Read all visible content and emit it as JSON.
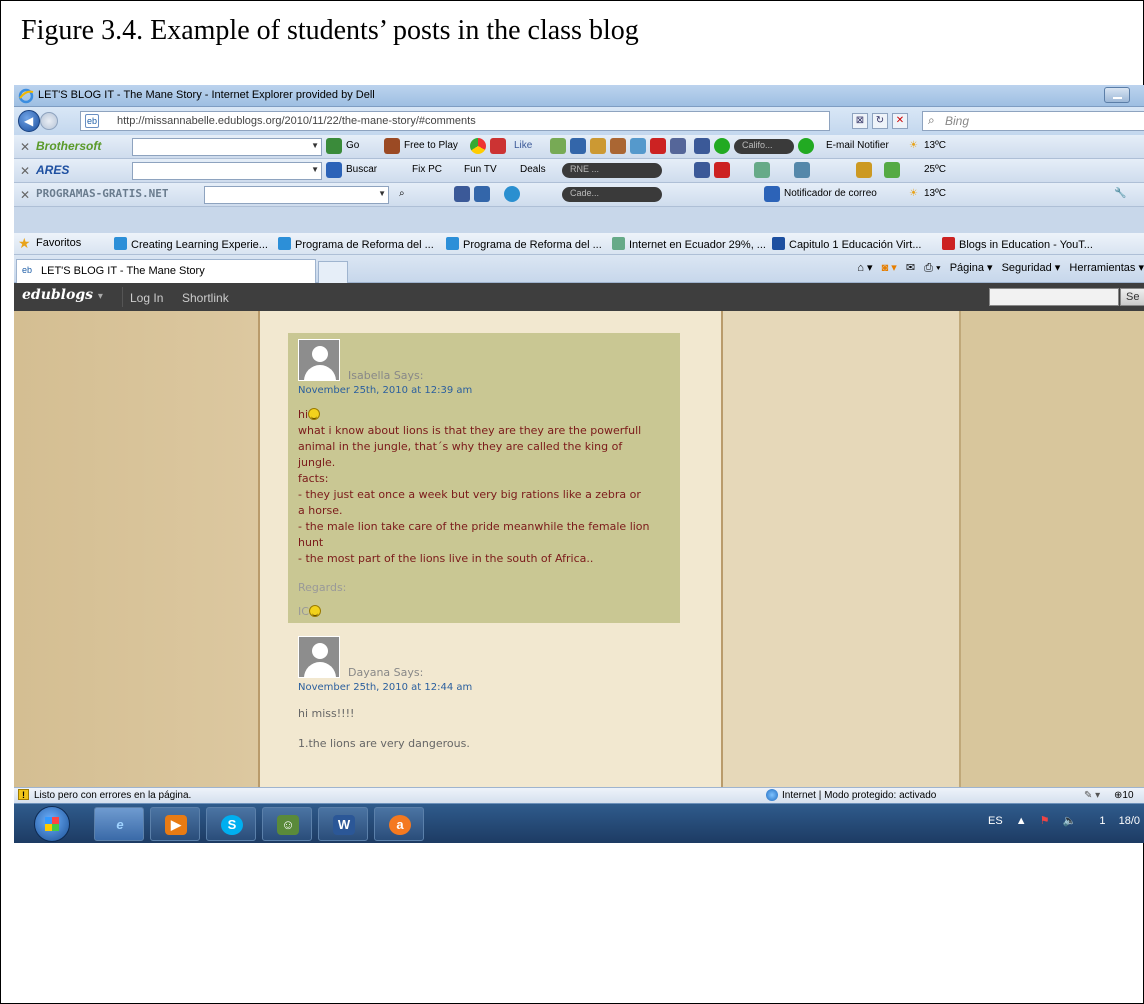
{
  "caption": "Figure 3.4. Example of students’ posts in the class blog",
  "browser": {
    "window_title": "LET'S BLOG IT - The Mane Story - Internet Explorer provided by Dell",
    "url": "http://missannabelle.edublogs.org/2010/11/22/the-mane-story/#comments",
    "search_placeholder": "Bing",
    "tab_title": "LET'S BLOG IT - The Mane Story",
    "cmd": {
      "pagina": "Página ▾",
      "seguridad": "Seguridad ▾",
      "herramientas": "Herramientas ▾"
    }
  },
  "toolbars": {
    "brothersoft": {
      "brand": "Brothersoft",
      "go": "Go",
      "free": "Free to Play",
      "like": "Like",
      "pill": "Califo...",
      "email": "E-mail Notifier",
      "temp": "13ºC"
    },
    "ares": {
      "brand": "ARES",
      "buscar": "Buscar",
      "fixpc": "Fix PC",
      "funtv": "Fun TV",
      "deals": "Deals",
      "pill": "RNE ...",
      "temp": "25ºC"
    },
    "programas": {
      "brand": "PROGRAMAS-GRATIS.NET",
      "pill": "Cade...",
      "notif": "Notificador de correo",
      "temp": "13ºC"
    }
  },
  "favorites": {
    "label": "Favoritos",
    "items": [
      "Creating Learning Experie...",
      "Programa de Reforma del ...",
      "Programa de Reforma del ...",
      "Internet en Ecuador 29%, ...",
      "Capitulo 1 Educación Virt...",
      "Blogs in Education - YouT..."
    ]
  },
  "edublogs": {
    "logo": "edublogs",
    "login": "Log In",
    "shortlink": "Shortlink",
    "search_btn": "Se"
  },
  "comments": [
    {
      "author_says": "Isabella Says:",
      "date": "November 25th, 2010 at 12:39 am",
      "greeting": "hi",
      "lines": [
        "what i know about lions is that they are they are the powerfull",
        "animal in the jungle, that´s why they are called the king of",
        "jungle.",
        "facts:",
        "- they just eat once a week but very big rations like a zebra or",
        "a horse.",
        "- the male lion take care of the pride meanwhile the female lion",
        "hunt",
        "- the most part of the lions live in the south of Africa.."
      ],
      "regards": "Regards:",
      "sign": "IC"
    },
    {
      "author_says": "Dayana Says:",
      "date": "November 25th, 2010 at 12:44 am",
      "lines": [
        "hi miss!!!!",
        "1.the lions are very dangerous."
      ]
    }
  ],
  "statusbar": {
    "message": "Listo pero con errores en la página.",
    "zone": "Internet | Modo protegido: activado",
    "zoom": "10"
  },
  "taskbar": {
    "lang": "ES",
    "time_partial": "1",
    "date_partial": "18/0"
  }
}
